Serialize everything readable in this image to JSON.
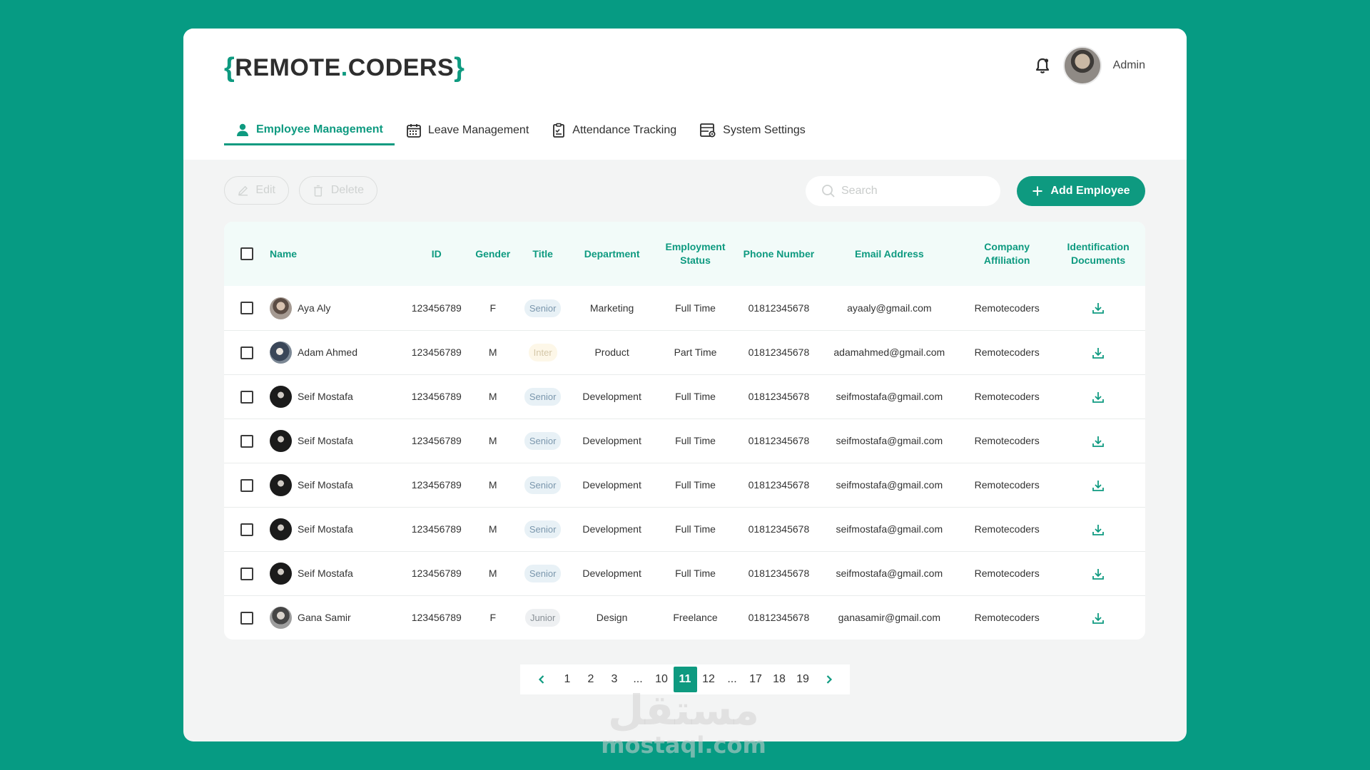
{
  "brand": {
    "open": "{",
    "part1": "REMOTE",
    "dot": ".",
    "part2": "CODERS",
    "close": "}"
  },
  "header": {
    "user_label": "Admin",
    "bell_icon": "bell-icon"
  },
  "tabs": [
    {
      "label": "Employee Management",
      "icon": "user-icon",
      "active": true
    },
    {
      "label": "Leave Management",
      "icon": "calendar-icon",
      "active": false
    },
    {
      "label": "Attendance Tracking",
      "icon": "clipboard-icon",
      "active": false
    },
    {
      "label": "System Settings",
      "icon": "settings-panel-icon",
      "active": false
    }
  ],
  "toolbar": {
    "edit_label": "Edit",
    "delete_label": "Delete",
    "search_placeholder": "Search",
    "add_label": "Add Employee"
  },
  "table": {
    "headers": {
      "name": "Name",
      "id": "ID",
      "gender": "Gender",
      "title": "Title",
      "department": "Department",
      "employment_1": "Employment",
      "employment_2": "Status",
      "phone": "Phone Number",
      "email": "Email Address",
      "company_1": "Company",
      "company_2": "Affiliation",
      "docs_1": "Identification",
      "docs_2": "Documents"
    },
    "rows": [
      {
        "name": "Aya Aly",
        "id": "123456789",
        "gender": "F",
        "title": "Senior",
        "department": "Marketing",
        "employment": "Full Time",
        "phone": "01812345678",
        "email": "ayaaly@gmail.com",
        "company": "Remotecoders"
      },
      {
        "name": "Adam Ahmed",
        "id": "123456789",
        "gender": "M",
        "title": "Inter",
        "department": "Product",
        "employment": "Part Time",
        "phone": "01812345678",
        "email": "adamahmed@gmail.com",
        "company": "Remotecoders"
      },
      {
        "name": "Seif Mostafa",
        "id": "123456789",
        "gender": "M",
        "title": "Senior",
        "department": "Development",
        "employment": "Full Time",
        "phone": "01812345678",
        "email": "seifmostafa@gmail.com",
        "company": "Remotecoders"
      },
      {
        "name": "Seif Mostafa",
        "id": "123456789",
        "gender": "M",
        "title": "Senior",
        "department": "Development",
        "employment": "Full Time",
        "phone": "01812345678",
        "email": "seifmostafa@gmail.com",
        "company": "Remotecoders"
      },
      {
        "name": "Seif Mostafa",
        "id": "123456789",
        "gender": "M",
        "title": "Senior",
        "department": "Development",
        "employment": "Full Time",
        "phone": "01812345678",
        "email": "seifmostafa@gmail.com",
        "company": "Remotecoders"
      },
      {
        "name": "Seif Mostafa",
        "id": "123456789",
        "gender": "M",
        "title": "Senior",
        "department": "Development",
        "employment": "Full Time",
        "phone": "01812345678",
        "email": "seifmostafa@gmail.com",
        "company": "Remotecoders"
      },
      {
        "name": "Seif Mostafa",
        "id": "123456789",
        "gender": "M",
        "title": "Senior",
        "department": "Development",
        "employment": "Full Time",
        "phone": "01812345678",
        "email": "seifmostafa@gmail.com",
        "company": "Remotecoders"
      },
      {
        "name": "Gana Samir",
        "id": "123456789",
        "gender": "F",
        "title": "Junior",
        "department": "Design",
        "employment": "Freelance",
        "phone": "01812345678",
        "email": "ganasamir@gmail.com",
        "company": "Remotecoders"
      }
    ]
  },
  "pagination": {
    "pages": [
      "1",
      "2",
      "3",
      "...",
      "10",
      "11",
      "12",
      "...",
      "17",
      "18",
      "19"
    ],
    "current": "11"
  },
  "watermark": {
    "arabic": "مستقل",
    "latin": "mostaql.com"
  },
  "colors": {
    "brand": "#0e9a80",
    "background": "#069b83"
  }
}
